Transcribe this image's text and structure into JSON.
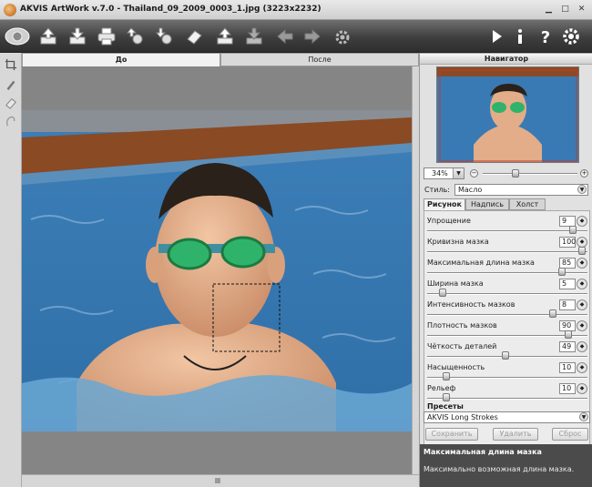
{
  "window": {
    "title": "AKVIS ArtWork v.7.0 - Thailand_09_2009_0003_1.jpg (3223x2232)",
    "controls": [
      "minimize-icon",
      "maximize-icon",
      "close-icon"
    ]
  },
  "toolbar": {
    "left_icons": [
      "logo-icon",
      "open-icon",
      "save-icon",
      "print-icon",
      "load-settings-icon",
      "save-settings-icon",
      "eraser-icon",
      "upload-icon",
      "download-icon",
      "back-arrow-icon",
      "forward-arrow-icon",
      "settings-gear-icon"
    ],
    "right_icons": [
      "run-icon",
      "info-icon",
      "help-icon",
      "preferences-gear-icon"
    ]
  },
  "tools": [
    "crop-icon",
    "brush-icon",
    "eraser-tool-icon",
    "hand-icon"
  ],
  "view": {
    "tabs": [
      {
        "label": "До",
        "active": true
      },
      {
        "label": "После",
        "active": false
      }
    ]
  },
  "navigator": {
    "title": "Навигатор",
    "zoom": "34%",
    "zoom_minus": "−",
    "zoom_plus": "+",
    "zoom_slider_level": 0.33
  },
  "style": {
    "label": "Стиль:",
    "value": "Масло"
  },
  "param_tabs": [
    {
      "label": "Рисунок",
      "active": true
    },
    {
      "label": "Надпись",
      "active": false
    },
    {
      "label": "Холст",
      "active": false
    }
  ],
  "params": [
    {
      "label": "Упрощение",
      "value": "9",
      "level": 0.93
    },
    {
      "label": "Кривизна мазка",
      "value": "100",
      "level": 0.99
    },
    {
      "label": "Максимальная длина мазка",
      "value": "85",
      "level": 0.86
    },
    {
      "label": "Ширина мазка",
      "value": "5",
      "level": 0.08
    },
    {
      "label": "Интенсивность мазков",
      "value": "8",
      "level": 0.8
    },
    {
      "label": "Плотность мазков",
      "value": "90",
      "level": 0.9
    },
    {
      "label": "Чёткость деталей",
      "value": "49",
      "level": 0.49
    },
    {
      "label": "Насыщенность",
      "value": "10",
      "level": 0.1
    },
    {
      "label": "Рельеф",
      "value": "10",
      "level": 0.1
    }
  ],
  "presets": {
    "title": "Пресеты",
    "value": "AKVIS Long Strokes",
    "buttons": [
      "Сохранить",
      "Удалить",
      "Сброс"
    ]
  },
  "help": {
    "title": "Максимальная длина мазка",
    "text": "Максимально возможная длина мазка."
  }
}
